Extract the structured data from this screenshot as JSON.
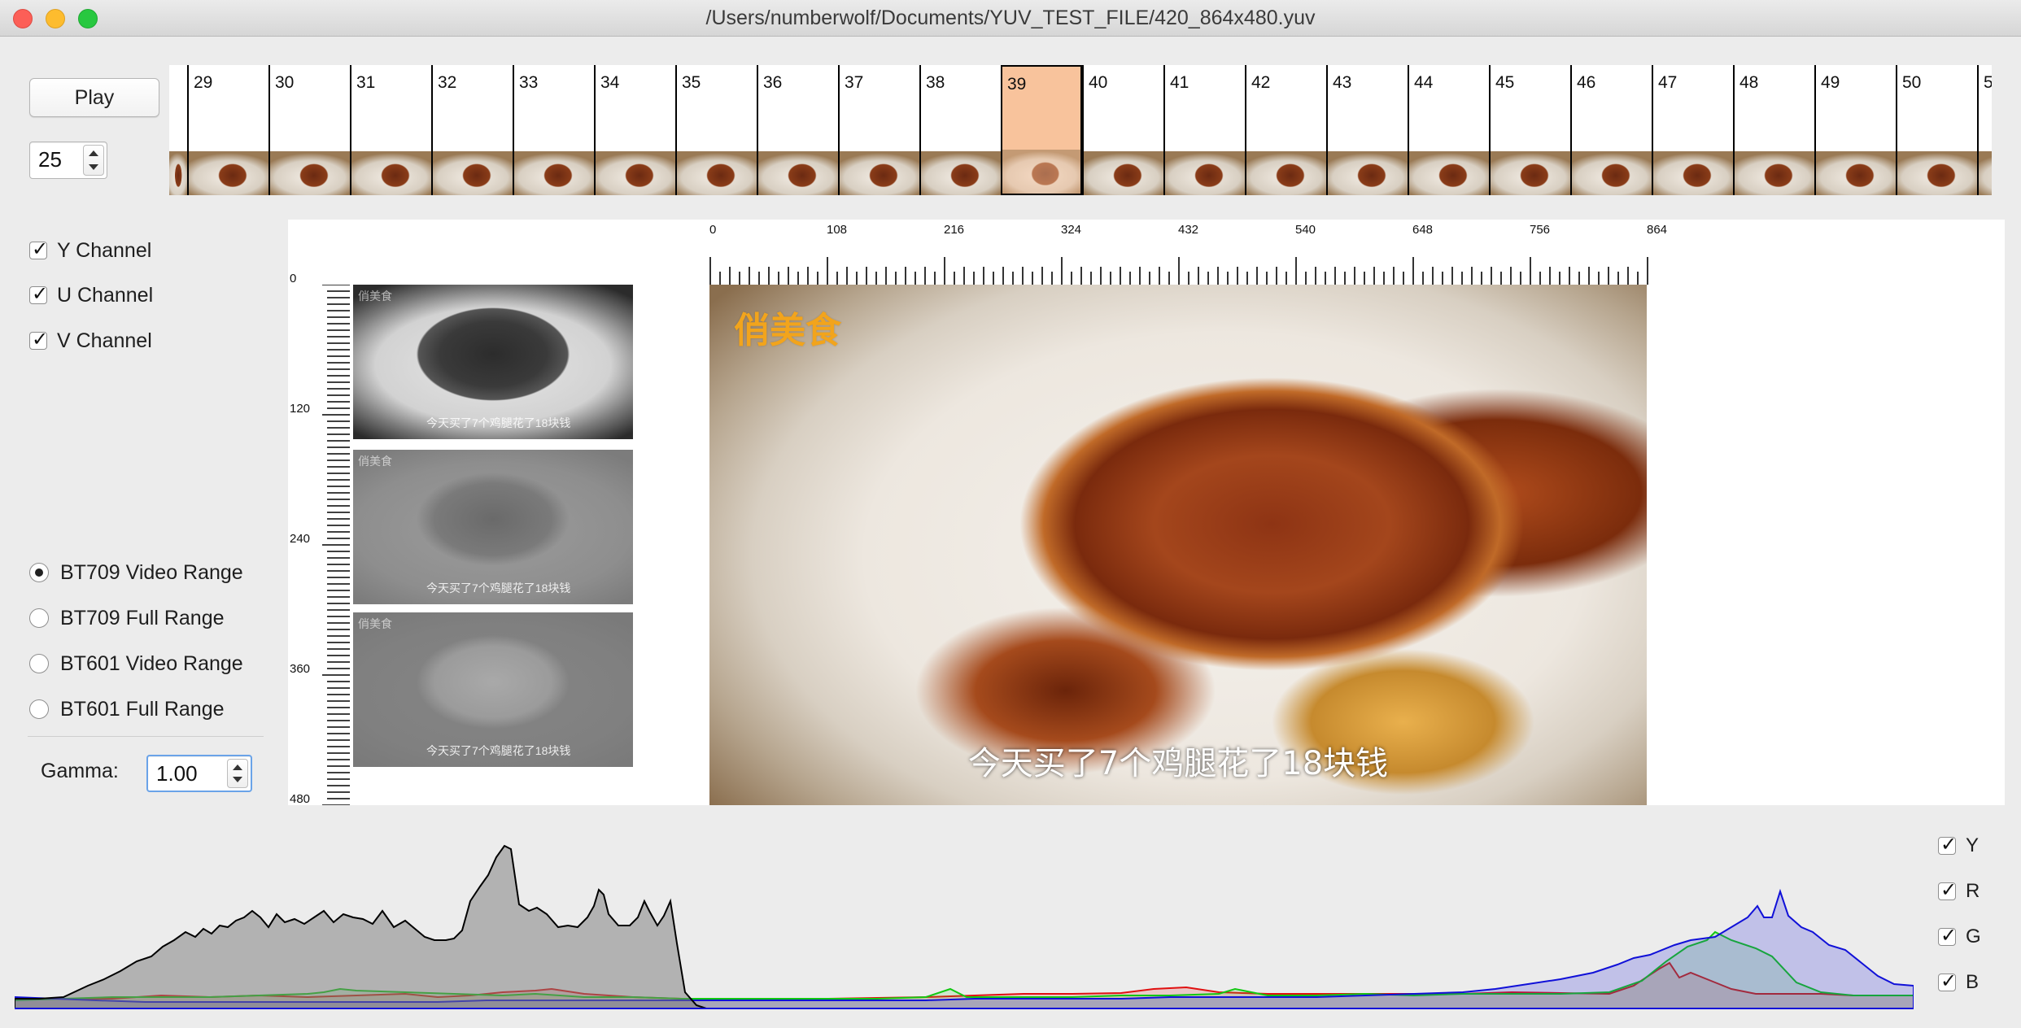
{
  "window": {
    "title": "/Users/numberwolf/Documents/YUV_TEST_FILE/420_864x480.yuv"
  },
  "controls": {
    "play_label": "Play",
    "fps_value": "25"
  },
  "filmstrip": {
    "frames": [
      "29",
      "30",
      "31",
      "32",
      "33",
      "34",
      "35",
      "36",
      "37",
      "38",
      "39",
      "40",
      "41",
      "42",
      "43",
      "44",
      "45",
      "46",
      "47",
      "48",
      "49",
      "50",
      "5"
    ],
    "selected_frame": "39"
  },
  "channels": {
    "y_label": "Y Channel",
    "u_label": "U Channel",
    "v_label": "V Channel",
    "y_checked": true,
    "u_checked": true,
    "v_checked": true
  },
  "color_range": {
    "options": [
      "BT709 Video Range",
      "BT709 Full Range",
      "BT601 Video Range",
      "BT601 Full Range"
    ],
    "selected": "BT709 Video Range"
  },
  "gamma": {
    "label": "Gamma:",
    "value": "1.00"
  },
  "rulers": {
    "horizontal_labels": [
      "0",
      "108",
      "216",
      "324",
      "432",
      "540",
      "648",
      "756",
      "864"
    ],
    "vertical_labels": [
      "0",
      "120",
      "240",
      "360",
      "480"
    ]
  },
  "image": {
    "watermark": "俏美食",
    "caption": "今天买了7个鸡腿花了18块钱"
  },
  "histogram": {
    "legend": [
      "Y",
      "R",
      "G",
      "B"
    ],
    "colors": {
      "Y": "#000000",
      "R": "#e01010",
      "G": "#12c812",
      "B": "#1010d8"
    }
  }
}
